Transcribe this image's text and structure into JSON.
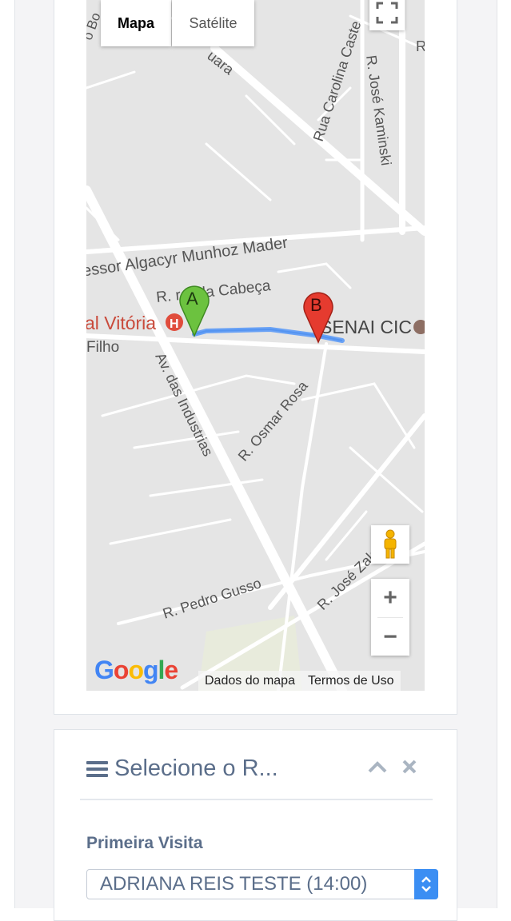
{
  "map": {
    "type_buttons": {
      "map_label": "Mapa",
      "satellite_label": "Satélite"
    },
    "street_labels": {
      "street_top": "uara",
      "rua_carolina": "Rua Carolina Caste",
      "r_jose_kaminski": "R. José Kaminski",
      "algacyr": "essor Algacyr Munhoz Mader",
      "cabeca": "R.  ra. da Cabeça",
      "vitoria": "al Vitória",
      "filho": "Filho",
      "senai": "SENAI CIC",
      "industrias": "Av. das Industrias",
      "osmar": "R. Osmar Rosa",
      "pedro": "R. Pedro Gusso",
      "jose_za": "R. José Zaleski",
      "r_top_right": "R",
      "bo": "o Bo"
    },
    "markers": {
      "start": "A",
      "end": "B"
    },
    "hospital_icon_letter": "H",
    "zoom": {
      "in": "+",
      "out": "−"
    },
    "attribution": {
      "data": "Dados do mapa",
      "terms": "Termos de Uso"
    },
    "logo": [
      "G",
      "o",
      "o",
      "g",
      "l",
      "e"
    ],
    "colors": {
      "route": "#6aa2f5",
      "marker_a": "#6cc23f",
      "marker_b": "#e53b2f",
      "road": "#ffffff",
      "land": "#e5e5e5"
    }
  },
  "route_panel": {
    "title": "Selecione o R...",
    "field_label": "Primeira Visita",
    "selected_option": "ADRIANA REIS TESTE (14:00)"
  }
}
